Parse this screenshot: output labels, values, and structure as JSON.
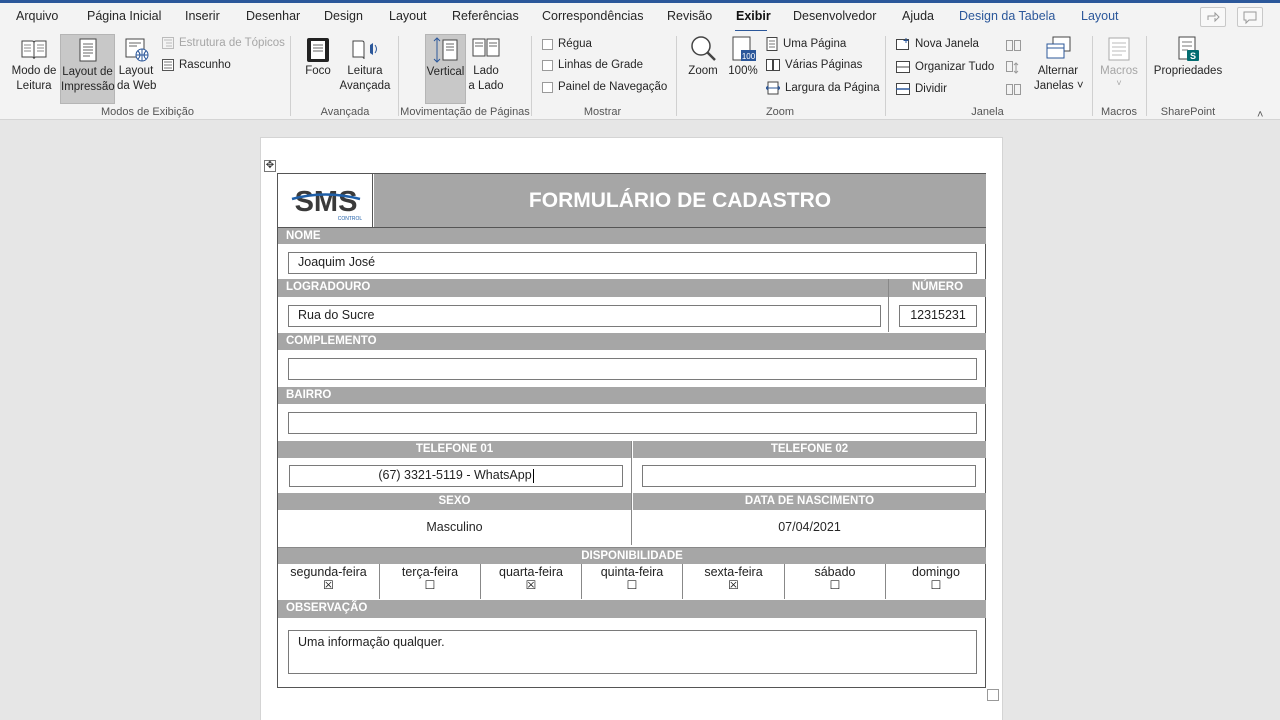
{
  "ribbon_tabs": {
    "arquivo": "Arquivo",
    "pagina_inicial": "Página Inicial",
    "inserir": "Inserir",
    "desenhar": "Desenhar",
    "design": "Design",
    "layout": "Layout",
    "referencias": "Referências",
    "correspondencias": "Correspondências",
    "revisao": "Revisão",
    "exibir": "Exibir",
    "desenvolvedor": "Desenvolvedor",
    "ajuda": "Ajuda",
    "design_tabela": "Design da Tabela",
    "layout_tabela": "Layout"
  },
  "modos": {
    "leitura_1": "Modo de",
    "leitura_2": "Leitura",
    "impressao_1": "Layout de",
    "impressao_2": "Impressão",
    "web_1": "Layout",
    "web_2": "da Web",
    "estrutura": "Estrutura de Tópicos",
    "rascunho": "Rascunho",
    "group": "Modos de Exibição"
  },
  "avancada": {
    "foco": "Foco",
    "leitura_1": "Leitura",
    "leitura_2": "Avançada",
    "group": "Avançada"
  },
  "movimentacao": {
    "vertical": "Vertical",
    "lado_1": "Lado",
    "lado_2": "a Lado",
    "group": "Movimentação de Páginas"
  },
  "mostrar": {
    "regua": "Régua",
    "linhas": "Linhas de Grade",
    "painel": "Painel de Navegação",
    "group": "Mostrar"
  },
  "zoom": {
    "zoom": "Zoom",
    "cem": "100%",
    "cem_icon": "100",
    "uma_pagina": "Uma Página",
    "varias": "Várias Páginas",
    "largura": "Largura da Página",
    "group": "Zoom"
  },
  "janela": {
    "nova": "Nova Janela",
    "organizar": "Organizar Tudo",
    "dividir": "Dividir",
    "alternar_1": "Alternar",
    "alternar_2": "Janelas ˅",
    "group": "Janela"
  },
  "macros": {
    "label": "Macros",
    "group": "Macros"
  },
  "sharepoint": {
    "label": "Propriedades",
    "group": "SharePoint"
  },
  "form": {
    "logo_text": "SMS",
    "logo_sub": "CONTROL",
    "title": "FORMULÁRIO DE CADASTRO",
    "nome_label": "NOME",
    "nome_value": "Joaquim José",
    "logradouro_label": "LOGRADOURO",
    "numero_label": "NÚMERO",
    "logradouro_value": "Rua do Sucre",
    "numero_value": "12315231",
    "complemento_label": "COMPLEMENTO",
    "complemento_value": "",
    "bairro_label": "BAIRRO",
    "bairro_value": "",
    "tel1_label": "TELEFONE 01",
    "tel2_label": "TELEFONE 02",
    "tel1_value": "(67) 3321-5119 - WhatsApp",
    "tel2_value": "",
    "sexo_label": "SEXO",
    "nasc_label": "DATA DE NASCIMENTO",
    "sexo_value": "Masculino",
    "nasc_value": "07/04/2021",
    "disp_label": "DISPONIBILIDADE",
    "days": [
      {
        "label": "segunda-feira",
        "mark": "☒"
      },
      {
        "label": "terça-feira",
        "mark": "☐"
      },
      {
        "label": "quarta-feira",
        "mark": "☒"
      },
      {
        "label": "quinta-feira",
        "mark": "☐"
      },
      {
        "label": "sexta-feira",
        "mark": "☒"
      },
      {
        "label": "sábado",
        "mark": "☐"
      },
      {
        "label": "domingo",
        "mark": "☐"
      }
    ],
    "obs_label": "OBSERVAÇÃO",
    "obs_value": "Uma informação qualquer."
  },
  "colors": {
    "accent": "#2b579a",
    "header_gray": "#a6a6a6",
    "logo_blue": "#1f5fa8",
    "logo_dark": "#3a3a3a"
  }
}
